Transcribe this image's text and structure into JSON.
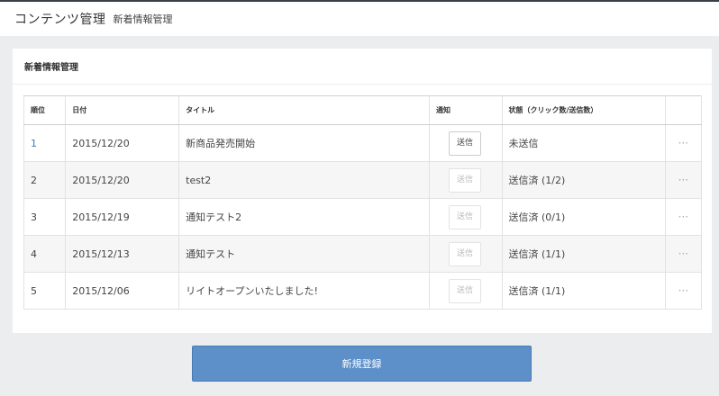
{
  "header": {
    "app_title": "コンテンツ管理",
    "subtitle": "新着情報管理"
  },
  "panel": {
    "title": "新着情報管理"
  },
  "table": {
    "columns": {
      "rank": "順位",
      "date": "日付",
      "title": "タイトル",
      "notify": "通知",
      "status": "状態（クリック数/送信数）"
    },
    "rows": [
      {
        "rank": "1",
        "date": "2015/12/20",
        "title": "新商品発売開始",
        "send_label": "送信",
        "send_enabled": true,
        "status": "未送信",
        "more": "···"
      },
      {
        "rank": "2",
        "date": "2015/12/20",
        "title": "test2",
        "send_label": "送信",
        "send_enabled": false,
        "status": "送信済 (1/2)",
        "more": "···"
      },
      {
        "rank": "3",
        "date": "2015/12/19",
        "title": "通知テスト2",
        "send_label": "送信",
        "send_enabled": false,
        "status": "送信済 (0/1)",
        "more": "···"
      },
      {
        "rank": "4",
        "date": "2015/12/13",
        "title": "通知テスト",
        "send_label": "送信",
        "send_enabled": false,
        "status": "送信済 (1/1)",
        "more": "···"
      },
      {
        "rank": "5",
        "date": "2015/12/06",
        "title": "リイトオープンいたしました!",
        "send_label": "送信",
        "send_enabled": false,
        "status": "送信済 (1/1)",
        "more": "···"
      }
    ]
  },
  "actions": {
    "register_label": "新規登録"
  },
  "colors": {
    "accent": "#5d8fc8",
    "link": "#3c7bb8",
    "background": "#ecedef"
  }
}
